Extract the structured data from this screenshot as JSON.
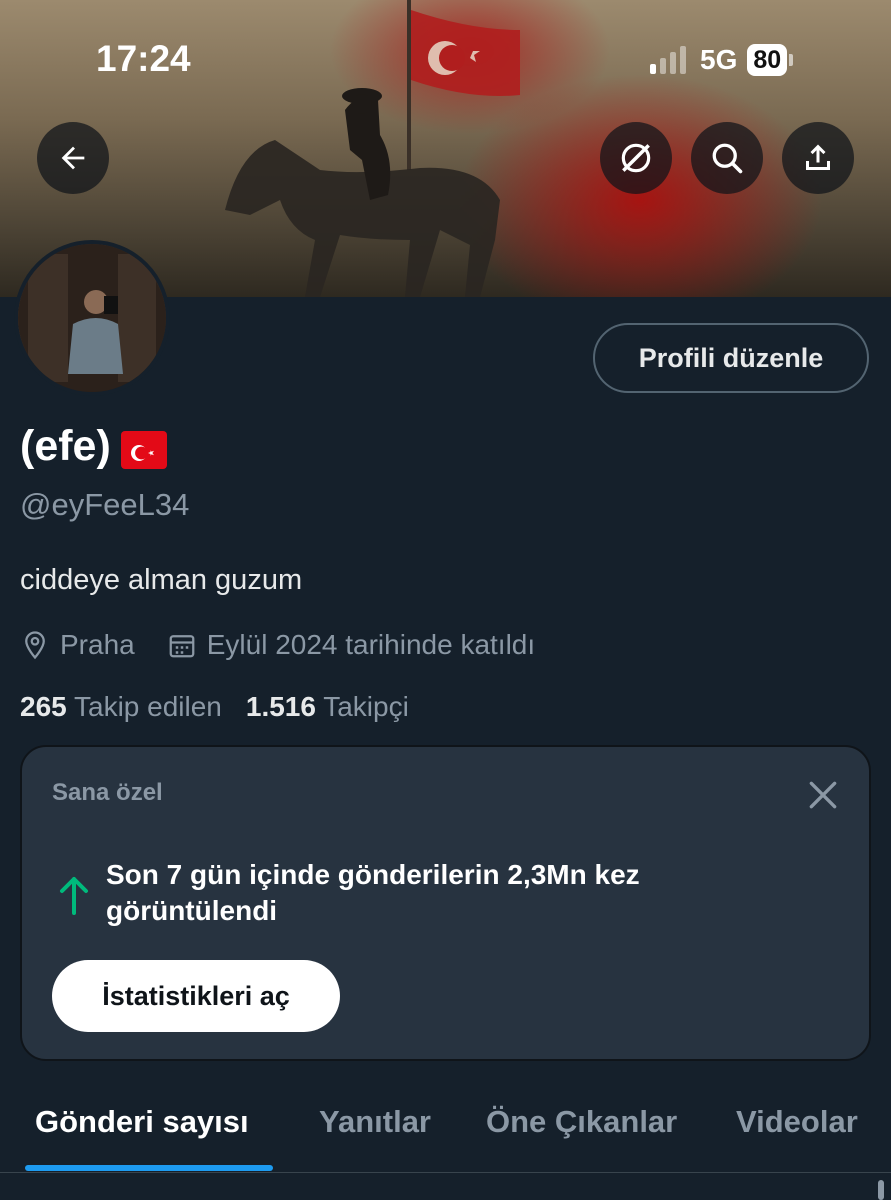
{
  "status_bar": {
    "time": "17:24",
    "network": "5G",
    "battery": "80"
  },
  "header": {
    "back_icon": "arrow-left-icon",
    "actions": [
      {
        "name": "grok-icon"
      },
      {
        "name": "search-icon"
      },
      {
        "name": "share-icon"
      }
    ]
  },
  "profile": {
    "edit_label": "Profili düzenle",
    "display_name": "(efe)",
    "name_emoji": "turkish-flag",
    "handle": "@eyFeeL34",
    "bio": "ciddeye alman guzum",
    "location": "Praha",
    "joined": "Eylül 2024 tarihinde katıldı",
    "following_count": "265",
    "following_label": "Takip edilen",
    "followers_count": "1.516",
    "followers_label": "Takipçi"
  },
  "insight_card": {
    "title": "Sana özel",
    "message": "Son 7 gün içinde gönderilerin 2,3Mn kez görüntülendi",
    "button_label": "İstatistikleri aç"
  },
  "tabs": [
    {
      "label": "Gönderi sayısı",
      "active": true
    },
    {
      "label": "Yanıtlar",
      "active": false
    },
    {
      "label": "Öne Çıkanlar",
      "active": false
    },
    {
      "label": "Videolar",
      "active": false
    }
  ],
  "colors": {
    "background": "#15202b",
    "accent": "#1d9bf0",
    "card": "#273340",
    "success": "#00ba7c"
  }
}
